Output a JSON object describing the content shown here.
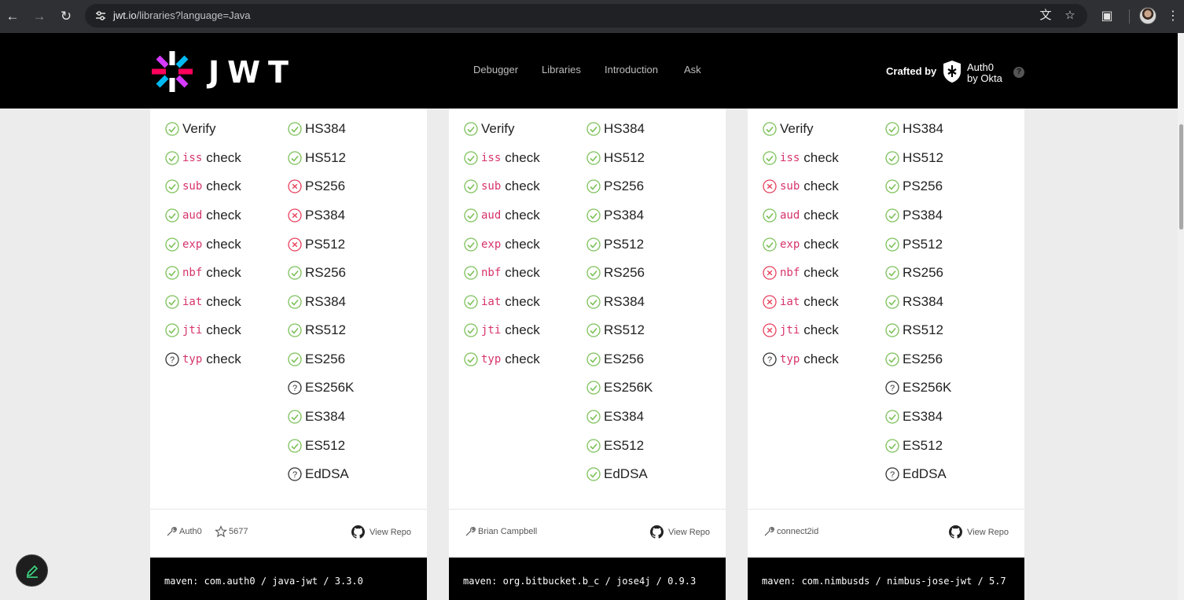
{
  "browser": {
    "url_host": "jwt.io",
    "url_path": "/libraries?language=Java"
  },
  "site": {
    "logo_text": "JWT",
    "nav": [
      "Debugger",
      "Libraries",
      "Introduction",
      "Ask"
    ],
    "crafted_by": "Crafted by",
    "auth0_line1": "Auth0",
    "auth0_line2": "by Okta",
    "help": "?"
  },
  "colors": {
    "check": "#7cc159",
    "cross": "#e8415e",
    "unknown": "#333333"
  },
  "cards": [
    {
      "claims": [
        {
          "code": "",
          "label": "Verify",
          "status": "check"
        },
        {
          "code": "iss",
          "label": "check",
          "status": "check"
        },
        {
          "code": "sub",
          "label": "check",
          "status": "check"
        },
        {
          "code": "aud",
          "label": "check",
          "status": "check"
        },
        {
          "code": "exp",
          "label": "check",
          "status": "check"
        },
        {
          "code": "nbf",
          "label": "check",
          "status": "check"
        },
        {
          "code": "iat",
          "label": "check",
          "status": "check"
        },
        {
          "code": "jti",
          "label": "check",
          "status": "check"
        },
        {
          "code": "typ",
          "label": "check",
          "status": "unknown"
        }
      ],
      "algorithms": [
        {
          "label": "HS384",
          "status": "check"
        },
        {
          "label": "HS512",
          "status": "check"
        },
        {
          "label": "PS256",
          "status": "cross"
        },
        {
          "label": "PS384",
          "status": "cross"
        },
        {
          "label": "PS512",
          "status": "cross"
        },
        {
          "label": "RS256",
          "status": "check"
        },
        {
          "label": "RS384",
          "status": "check"
        },
        {
          "label": "RS512",
          "status": "check"
        },
        {
          "label": "ES256",
          "status": "check"
        },
        {
          "label": "ES256K",
          "status": "unknown"
        },
        {
          "label": "ES384",
          "status": "check"
        },
        {
          "label": "ES512",
          "status": "check"
        },
        {
          "label": "EdDSA",
          "status": "unknown"
        }
      ],
      "maintainer": "Auth0",
      "stars": "5677",
      "view_repo": "View Repo",
      "maven": "maven: com.auth0 / java-jwt / 3.3.0"
    },
    {
      "claims": [
        {
          "code": "",
          "label": "Verify",
          "status": "check"
        },
        {
          "code": "iss",
          "label": "check",
          "status": "check"
        },
        {
          "code": "sub",
          "label": "check",
          "status": "check"
        },
        {
          "code": "aud",
          "label": "check",
          "status": "check"
        },
        {
          "code": "exp",
          "label": "check",
          "status": "check"
        },
        {
          "code": "nbf",
          "label": "check",
          "status": "check"
        },
        {
          "code": "iat",
          "label": "check",
          "status": "check"
        },
        {
          "code": "jti",
          "label": "check",
          "status": "check"
        },
        {
          "code": "typ",
          "label": "check",
          "status": "check"
        }
      ],
      "algorithms": [
        {
          "label": "HS384",
          "status": "check"
        },
        {
          "label": "HS512",
          "status": "check"
        },
        {
          "label": "PS256",
          "status": "check"
        },
        {
          "label": "PS384",
          "status": "check"
        },
        {
          "label": "PS512",
          "status": "check"
        },
        {
          "label": "RS256",
          "status": "check"
        },
        {
          "label": "RS384",
          "status": "check"
        },
        {
          "label": "RS512",
          "status": "check"
        },
        {
          "label": "ES256",
          "status": "check"
        },
        {
          "label": "ES256K",
          "status": "check"
        },
        {
          "label": "ES384",
          "status": "check"
        },
        {
          "label": "ES512",
          "status": "check"
        },
        {
          "label": "EdDSA",
          "status": "check"
        }
      ],
      "maintainer": "Brian Campbell",
      "stars": "",
      "view_repo": "View Repo",
      "maven": "maven: org.bitbucket.b_c / jose4j / 0.9.3"
    },
    {
      "claims": [
        {
          "code": "",
          "label": "Verify",
          "status": "check"
        },
        {
          "code": "iss",
          "label": "check",
          "status": "check"
        },
        {
          "code": "sub",
          "label": "check",
          "status": "cross"
        },
        {
          "code": "aud",
          "label": "check",
          "status": "check"
        },
        {
          "code": "exp",
          "label": "check",
          "status": "check"
        },
        {
          "code": "nbf",
          "label": "check",
          "status": "cross"
        },
        {
          "code": "iat",
          "label": "check",
          "status": "cross"
        },
        {
          "code": "jti",
          "label": "check",
          "status": "cross"
        },
        {
          "code": "typ",
          "label": "check",
          "status": "unknown"
        }
      ],
      "algorithms": [
        {
          "label": "HS384",
          "status": "check"
        },
        {
          "label": "HS512",
          "status": "check"
        },
        {
          "label": "PS256",
          "status": "check"
        },
        {
          "label": "PS384",
          "status": "check"
        },
        {
          "label": "PS512",
          "status": "check"
        },
        {
          "label": "RS256",
          "status": "check"
        },
        {
          "label": "RS384",
          "status": "check"
        },
        {
          "label": "RS512",
          "status": "check"
        },
        {
          "label": "ES256",
          "status": "check"
        },
        {
          "label": "ES256K",
          "status": "unknown"
        },
        {
          "label": "ES384",
          "status": "check"
        },
        {
          "label": "ES512",
          "status": "check"
        },
        {
          "label": "EdDSA",
          "status": "unknown"
        }
      ],
      "maintainer": "connect2id",
      "stars": "",
      "view_repo": "View Repo",
      "maven": "maven: com.nimbusds / nimbus-jose-jwt / 5.7"
    }
  ]
}
